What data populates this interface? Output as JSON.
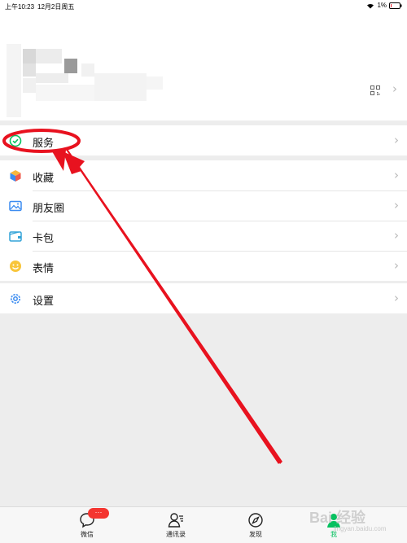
{
  "statusbar": {
    "time": "上午10:23",
    "date": "12月2日周五",
    "battery": "1%"
  },
  "menu": {
    "service": "服务",
    "favorites": "收藏",
    "moments": "朋友圈",
    "cards": "卡包",
    "stickers": "表情",
    "settings": "设置"
  },
  "tabs": {
    "chats": "微信",
    "contacts": "通讯录",
    "discover": "发现",
    "me": "我"
  },
  "badge": "···",
  "watermark": {
    "main": "Bai 经验",
    "sub": "jingyan.baidu.com"
  },
  "colors": {
    "accent": "#07c160",
    "annotation": "#e8121f",
    "badge": "#f43530"
  }
}
